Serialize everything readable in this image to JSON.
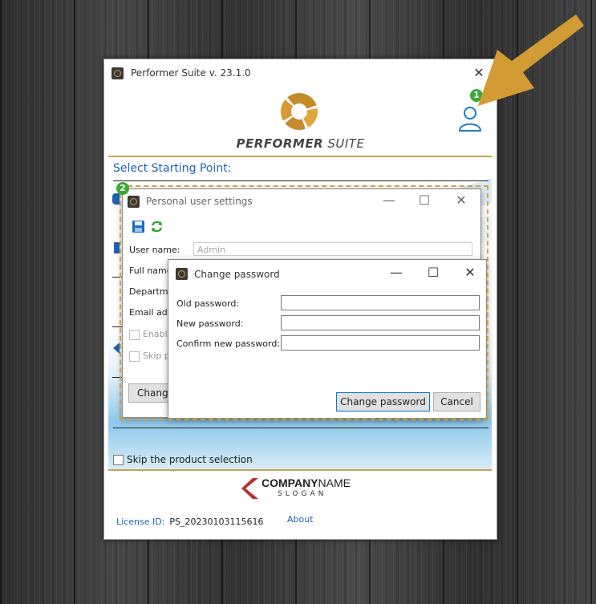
{
  "main_window": {
    "title": "Performer Suite v. 23.1.0",
    "close_glyph": "✕",
    "brand_part1": "PERFORMER",
    "brand_part2": " SUITE",
    "select_label": "Select Starting Point:",
    "skip_label": "Skip the product selection",
    "license_label": "License ID:",
    "license_value": "PS_20230103115616",
    "about": "About",
    "company_part1": "COMPANY",
    "company_part2": "NAME",
    "slogan": "SLOGAN"
  },
  "personal_settings": {
    "title": "Personal user settings",
    "min_glyph": "—",
    "max_glyph": "☐",
    "close_glyph": "✕",
    "user_name_label": "User name:",
    "user_name_value": "Admin",
    "full_name_label": "Full name",
    "department_label": "Departme",
    "email_label": "Email ado",
    "enable_label": "Enable",
    "skip_label": "Skip p",
    "change_button": "Change"
  },
  "change_password": {
    "title": "Change password",
    "min_glyph": "—",
    "max_glyph": "☐",
    "close_glyph": "✕",
    "old_label": "Old password:",
    "new_label": "New password:",
    "confirm_label": "Confirm new password:",
    "old_value": "",
    "new_value": "",
    "confirm_value": "",
    "change_button": "Change password",
    "cancel_button": "Cancel"
  },
  "annotations": {
    "badge1": "1",
    "badge2": "2",
    "arrow_color": "#d29b34",
    "dash_color": "#d3a042",
    "badge_color": "#3aa935"
  },
  "colors": {
    "accent_blue": "#1c64b3",
    "gold": "#c9a25a"
  }
}
